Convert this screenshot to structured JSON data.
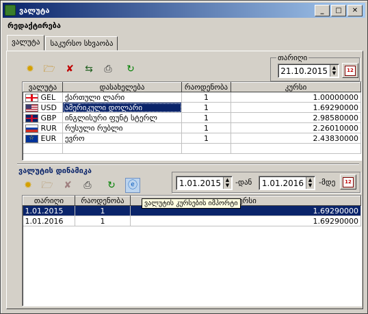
{
  "window": {
    "title": "ვალუტა"
  },
  "menu": {
    "edit": "რედაქტირება"
  },
  "tabs": [
    {
      "label": "ვალუტა"
    },
    {
      "label": "საკურსო სხვაობა"
    }
  ],
  "date_group": {
    "legend": "თარიღი",
    "value": "21.10.2015"
  },
  "currencies": {
    "headers": [
      "ვალუტა",
      "დასახელება",
      "რაოდენობა",
      "კურსი"
    ],
    "rows": [
      {
        "code": "GEL",
        "flag": "georgia-flag",
        "name": "ქართული ლარი",
        "qty": "1",
        "rate": "1.00000000"
      },
      {
        "code": "USD",
        "flag": "usa-flag",
        "name": "ამერიკული დოლარი",
        "qty": "1",
        "rate": "1.69290000"
      },
      {
        "code": "GBP",
        "flag": "uk-flag",
        "name": "ინგლისური ფუნტ სტერლ",
        "qty": "1",
        "rate": "2.98580000"
      },
      {
        "code": "RUR",
        "flag": "russia-flag",
        "name": "რუსული რუბლი",
        "qty": "1",
        "rate": "2.26010000"
      },
      {
        "code": "EUR",
        "flag": "eu-flag",
        "name": "ევრო",
        "qty": "1",
        "rate": "2.43830000"
      }
    ]
  },
  "dynamics": {
    "title": "ვალუტის დინამიკა",
    "from_value": "1.01.2015",
    "from_suffix": "-დან",
    "to_value": "1.01.2016",
    "to_suffix": "-მდე",
    "headers": [
      "თარიღი",
      "რაოდენობა",
      "კურსი"
    ],
    "rows": [
      {
        "date": "1.01.2015",
        "qty": "1",
        "rate": "1.69290000"
      },
      {
        "date": "1.01.2016",
        "qty": "1",
        "rate": "1.69290000"
      }
    ],
    "tooltip": "ვალუტის კურსების იმპორტი"
  },
  "colors": {
    "title_start": "#0a246a",
    "title_end": "#a6caf0",
    "selection": "#0a246a",
    "face": "#d4d0c8"
  }
}
